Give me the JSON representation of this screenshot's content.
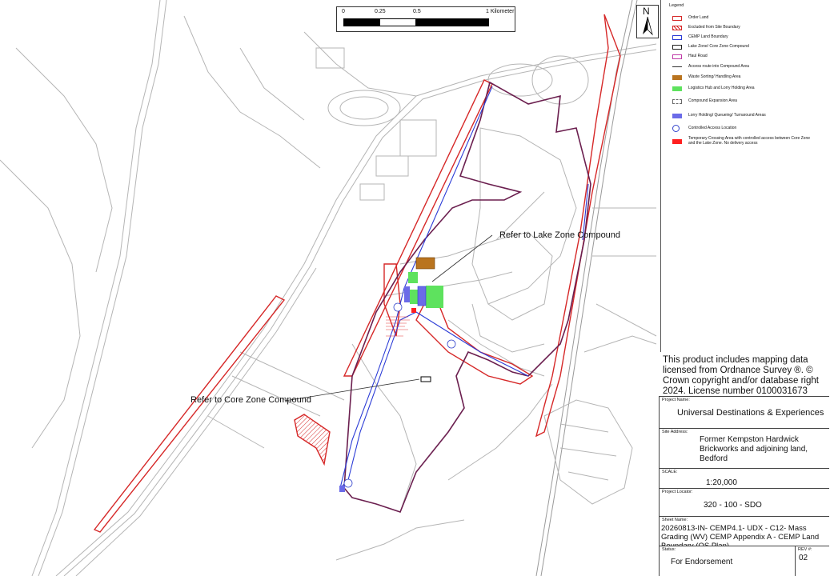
{
  "scale_bar": {
    "ticks": [
      "0",
      "0.25",
      "0.5",
      "1 Kilometer"
    ]
  },
  "north_arrow": {
    "label": "N"
  },
  "legend": {
    "title": "Legend",
    "items": [
      {
        "label": "Order Land",
        "symbol": "outline",
        "color": "#d62828"
      },
      {
        "label": "Excluded from Site Boundary",
        "symbol": "hatch",
        "color": "#d62828"
      },
      {
        "label": "CEMP Land Boundary",
        "symbol": "outline",
        "color": "#2b3bd6"
      },
      {
        "label": "Lake Zone/ Core Zone Compound",
        "symbol": "outline",
        "color": "#222222"
      },
      {
        "label": "Haul Road",
        "symbol": "outline",
        "color": "#c03aa8"
      },
      {
        "label": "Access route into Compound Area",
        "symbol": "line",
        "color": "#333333"
      },
      {
        "label": "Waste Sorting/ Handling Area",
        "symbol": "fill",
        "color": "#b9741f"
      },
      {
        "label": "Logistics Hub and Lorry Holding Area",
        "symbol": "fill",
        "color": "#5ee25e"
      },
      {
        "label": "Compound Expansion Area",
        "symbol": "dashed",
        "color": "#6a6a6a"
      },
      {
        "label": "Lorry Holding/ Queueing/ Turnaround Areas",
        "symbol": "fill",
        "color": "#6b6be8"
      },
      {
        "label": "Controlled Access Location",
        "symbol": "circle",
        "color": "#3344cc"
      },
      {
        "label": "Temporary Crossing Area with controlled access between Core Zone and the Lake Zone. No delivery access",
        "symbol": "fill",
        "color": "#ff1f1f"
      }
    ]
  },
  "os_notice": "This product includes mapping data licensed from Ordnance Survey ®.  © Crown copyright and/or database right 2024.  License number 0100031673 2024",
  "callouts": {
    "lake": "Refer to Lake Zone Compound",
    "core": "Refer to Core Zone Compound"
  },
  "title_block": {
    "project_name_label": "Project Name:",
    "project_name": "Universal Destinations & Experiences",
    "site_address_label": "Site Address:",
    "site_address": "Former Kempston Hardwick Brickworks and adjoining land, Bedford",
    "scale_label": "SCALE:",
    "scale": "1:20,000",
    "project_locator_label": "Project Locator:",
    "project_locator": "320  -  100  -  SDO",
    "sheet_name_label": "Sheet Name:",
    "sheet_name": "20260813-IN- CEMP4.1- UDX - C12- Mass Grading (WV) CEMP Appendix A - CEMP Land Boundary (OS Plan)",
    "status_label": "Status:",
    "status": "For Endorsement",
    "rev_label": "REV #:",
    "rev": "02"
  },
  "colors": {
    "order_land": "#d62828",
    "cemp": "#2b3bd6",
    "haul": "#7a1f5c",
    "base_map": "#b9b9b9"
  }
}
